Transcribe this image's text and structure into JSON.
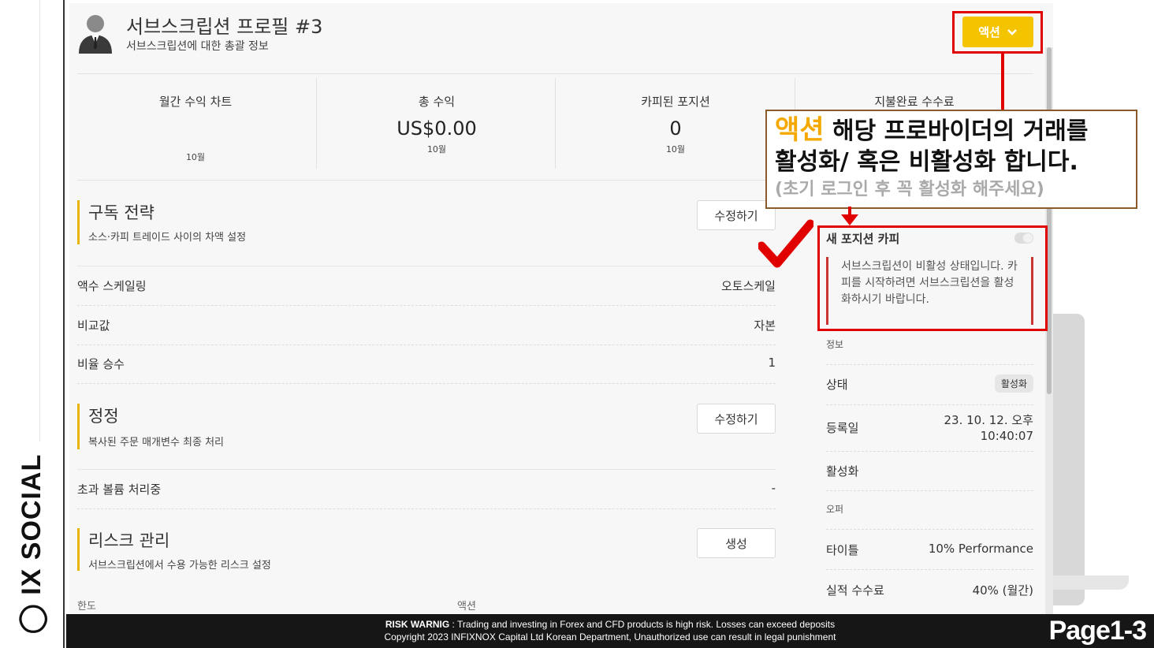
{
  "brand": {
    "ix": "IX",
    "name": "SOCIAL"
  },
  "header": {
    "title": "서브스크립션 프로필 #3",
    "subtitle": "서브스크립션에 대한 총괄 정보",
    "action_label": "액션"
  },
  "stats": [
    {
      "label": "월간 수익 차트",
      "value": "",
      "sub": "10월"
    },
    {
      "label": "총 수익",
      "value": "US$0.00",
      "sub": "10월"
    },
    {
      "label": "카피된 포지션",
      "value": "0",
      "sub": "10월"
    },
    {
      "label": "지불완료 수수료",
      "value": "",
      "sub": ""
    }
  ],
  "sections": {
    "strategy": {
      "title": "구독 전략",
      "desc": "소스·카피 트레이드 사이의 차액 설정",
      "button": "수정하기"
    },
    "correction": {
      "title": "정정",
      "desc": "복사된 주문 매개변수 최종 처리",
      "button": "수정하기"
    },
    "risk": {
      "title": "리스크 관리",
      "desc": "서브스크립션에서 수용 가능한 리스크 설정",
      "button": "생성"
    }
  },
  "rows": {
    "scaling": {
      "label": "액수 스케일링",
      "value": "오토스케일"
    },
    "compare": {
      "label": "비교값",
      "value": "자본"
    },
    "ratio": {
      "label": "비율 승수",
      "value": "1"
    },
    "excess": {
      "label": "초과 볼륨 처리중",
      "value": "-"
    }
  },
  "limits": {
    "label": "한도",
    "action": "액션"
  },
  "right": {
    "copy_title": "새 포지션 카피",
    "copy_enabled": false,
    "notice": "서브스크립션이 비활성 상태입니다. 카피를 시작하려면 서브스크립션을 활성화하시기 바랍니다.",
    "info_label": "정보",
    "status_key": "상태",
    "status_value": "활성화",
    "registered_key": "등록일",
    "registered_date": "23. 10. 12. 오후",
    "registered_time": "10:40:07",
    "activation_key": "활성화",
    "offer_label": "오퍼",
    "title_key": "타이틀",
    "title_value": "10% Performance",
    "fee_key": "실적 수수료",
    "fee_value": "40% (월간)"
  },
  "callout": {
    "keyword": "액션",
    "line1_rest": " 해당 프로바이더의 거래를",
    "line2": "활성화/ 혹은 비활성화 합니다.",
    "line3": "(초기 로그인 후 꼭 활성화 해주세요)"
  },
  "footer": {
    "warning_title": "RISK WARNIG",
    "warning_text": " : Trading and investing in Forex and CFD products is high risk. Losses can exceed deposits",
    "copyright": "Copyright 2023 INFIXNOX Capital Ltd Korean Department, Unauthorized use can result in legal punishment",
    "page_label": "Page1-3"
  },
  "colors": {
    "accent": "#f5c400",
    "annotation_red": "#e00000",
    "callout_keyword": "#f5a800",
    "section_bar": "#e8b400"
  }
}
